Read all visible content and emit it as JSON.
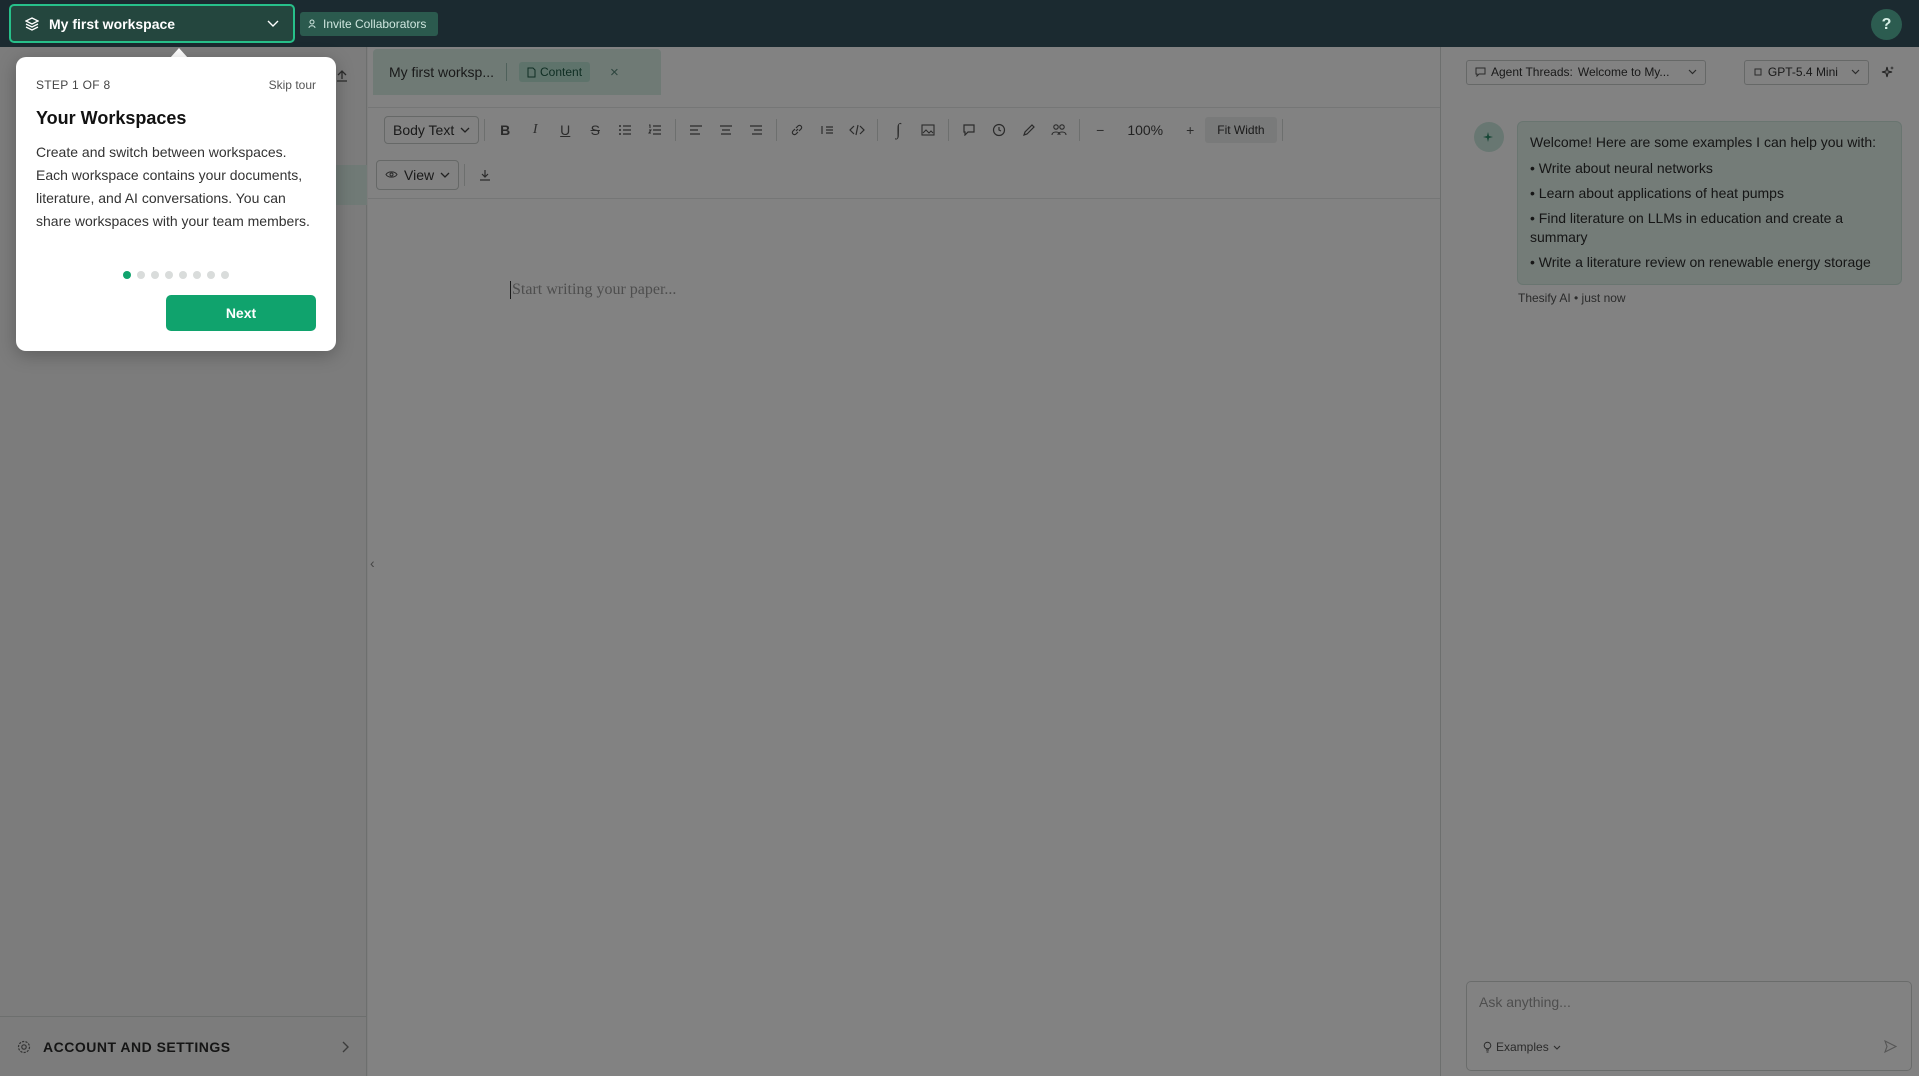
{
  "topbar": {
    "workspace_name": "My first workspace",
    "invite_label": "Invite Collaborators",
    "help_label": "?"
  },
  "sidebar": {
    "account_label": "ACCOUNT AND SETTINGS"
  },
  "editor": {
    "tab_title": "My first worksp...",
    "tab_pill": "Content",
    "tab_close": "×",
    "style_select": "Body Text",
    "zoom": "100%",
    "fit_width": "Fit Width",
    "view_select": "View",
    "placeholder": "Start writing your paper..."
  },
  "rpanel": {
    "agent_label": "Agent Threads:",
    "agent_value": "Welcome to My...",
    "model": "GPT-5.4 Mini",
    "welcome": "Welcome! Here are some examples I can help you with:",
    "examples": [
      "• Write about neural networks",
      "• Learn about applications of heat pumps",
      "• Find literature on LLMs in education and create a summary",
      "• Write a literature review on renewable energy storage"
    ],
    "meta": "Thesify AI • just now",
    "input_placeholder": "Ask anything...",
    "examples_label": "Examples"
  },
  "tour": {
    "step": "STEP 1 OF 8",
    "skip": "Skip tour",
    "title": "Your Workspaces",
    "body": "Create and switch between workspaces. Each workspace contains your documents, literature, and AI conversations. You can share workspaces with your team members.",
    "next": "Next",
    "total_steps": 8,
    "current_step": 1
  },
  "colors": {
    "accent": "#10a36d",
    "topbar": "#1b2a30"
  }
}
